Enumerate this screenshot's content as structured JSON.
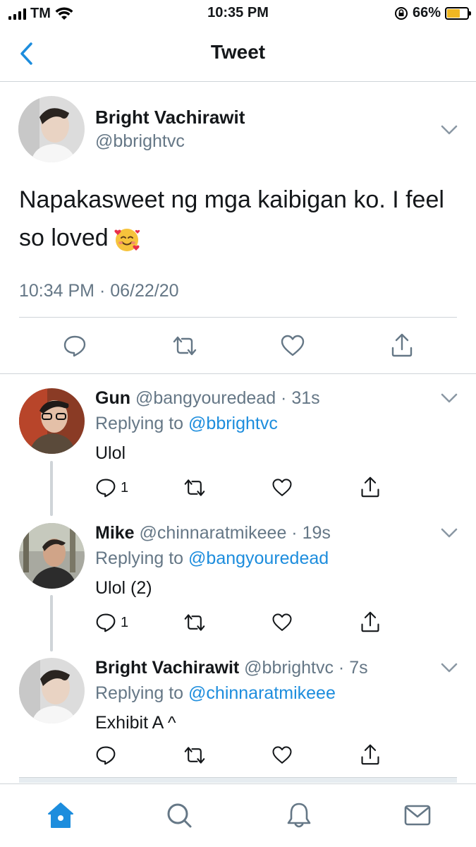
{
  "status_bar": {
    "carrier": "TM",
    "time": "10:35 PM",
    "battery": "66%",
    "battery_level": 0.66
  },
  "header": {
    "title": "Tweet"
  },
  "main_tweet": {
    "name": "Bright Vachirawit",
    "handle": "@bbrightvc",
    "text": "Napakasweet ng mga kaibigan ko. I feel so loved",
    "timestamp": "10:34 PM · 06/22/20"
  },
  "replies": [
    {
      "name": "Gun",
      "handle_time": "@bangyouredead · 31s",
      "replying_prefix": "Replying to",
      "replying_to": "@bbrightvc",
      "text": "Ulol",
      "reply_count": "1"
    },
    {
      "name": "Mike",
      "handle_time": "@chinnaratmikeee · 19s",
      "replying_prefix": "Replying to",
      "replying_to": "@bangyouredead",
      "text": "Ulol (2)",
      "reply_count": "1"
    },
    {
      "name": "Bright Vachirawit",
      "handle_time": "@bbrightvc · 7s",
      "replying_prefix": "Replying to",
      "replying_to": "@chinnaratmikeee",
      "text": "Exhibit A ^",
      "reply_count": ""
    }
  ],
  "colors": {
    "accent": "#1d8ddd",
    "secondary_text": "#657786",
    "divider": "#cfd4d8",
    "battery_charge": "#f0b722"
  },
  "icons": {
    "back": "chevron-left-icon",
    "reply": "speech-bubble-icon",
    "retweet": "retweet-icon",
    "like": "heart-icon",
    "share": "share-icon",
    "more": "chevron-down-icon",
    "tabs": [
      "home-icon",
      "search-icon",
      "bell-icon",
      "mail-icon"
    ]
  }
}
